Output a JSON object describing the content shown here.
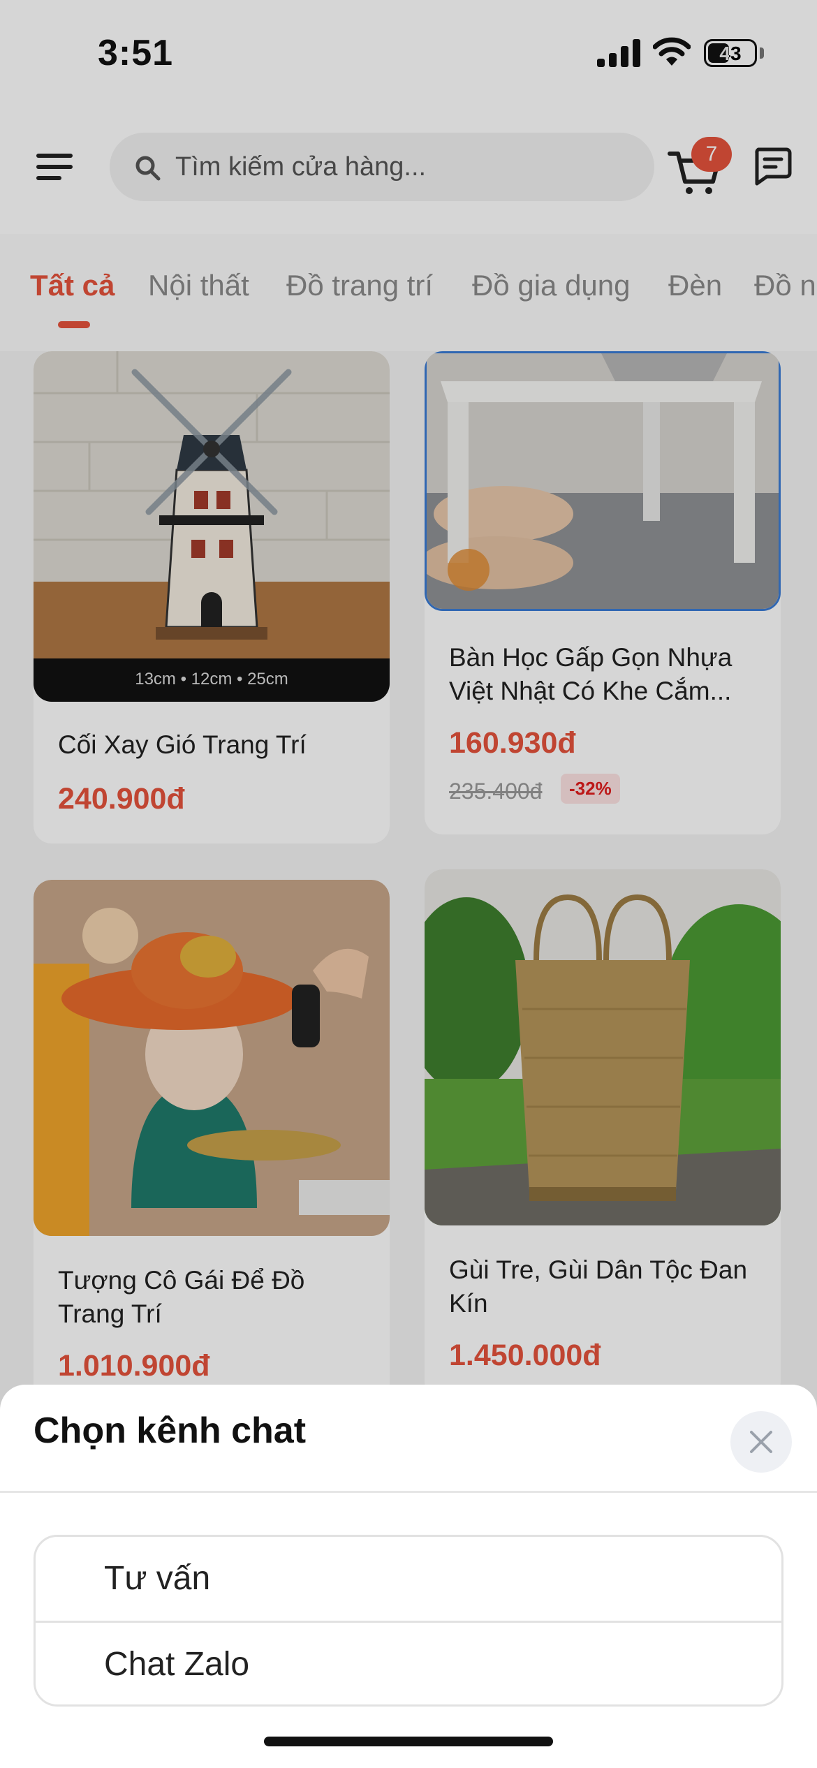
{
  "status_bar": {
    "time": "3:51",
    "battery": "43"
  },
  "header": {
    "search_placeholder": "Tìm kiếm cửa hàng...",
    "cart_count": "7"
  },
  "tabs": [
    {
      "label": "Tất cả",
      "active": true
    },
    {
      "label": "Nội thất"
    },
    {
      "label": "Đồ trang trí"
    },
    {
      "label": "Đồ gia dụng"
    },
    {
      "label": "Đèn"
    },
    {
      "label": "Đồ n"
    }
  ],
  "products": [
    {
      "name": "Cối Xay Gió Trang Trí",
      "price": "240.900đ",
      "image_caption": "13cm  • 12cm  • 25cm"
    },
    {
      "name": "Bàn Học Gấp Gọn Nhựa Việt Nhật Có Khe Cắm...",
      "price": "160.930đ",
      "old_price": "235.400đ",
      "discount": "-32%"
    },
    {
      "name": "Tượng Cô Gái Để Đồ Trang Trí",
      "price": "1.010.900đ"
    },
    {
      "name": "Gùi Tre, Gùi Dân Tộc Đan Kín",
      "price": "1.450.000đ"
    }
  ],
  "sheet": {
    "title": "Chọn kênh chat",
    "options": [
      {
        "label": "Tư vấn"
      },
      {
        "label": "Chat Zalo"
      }
    ]
  },
  "colors": {
    "accent": "#e5533c",
    "discount_text": "#e11d1d",
    "discount_bg": "#fde3e3"
  },
  "icons": {
    "menu": "menu-icon",
    "search": "search-icon",
    "cart": "cart-icon",
    "chat": "chat-icon",
    "close": "close-icon"
  }
}
